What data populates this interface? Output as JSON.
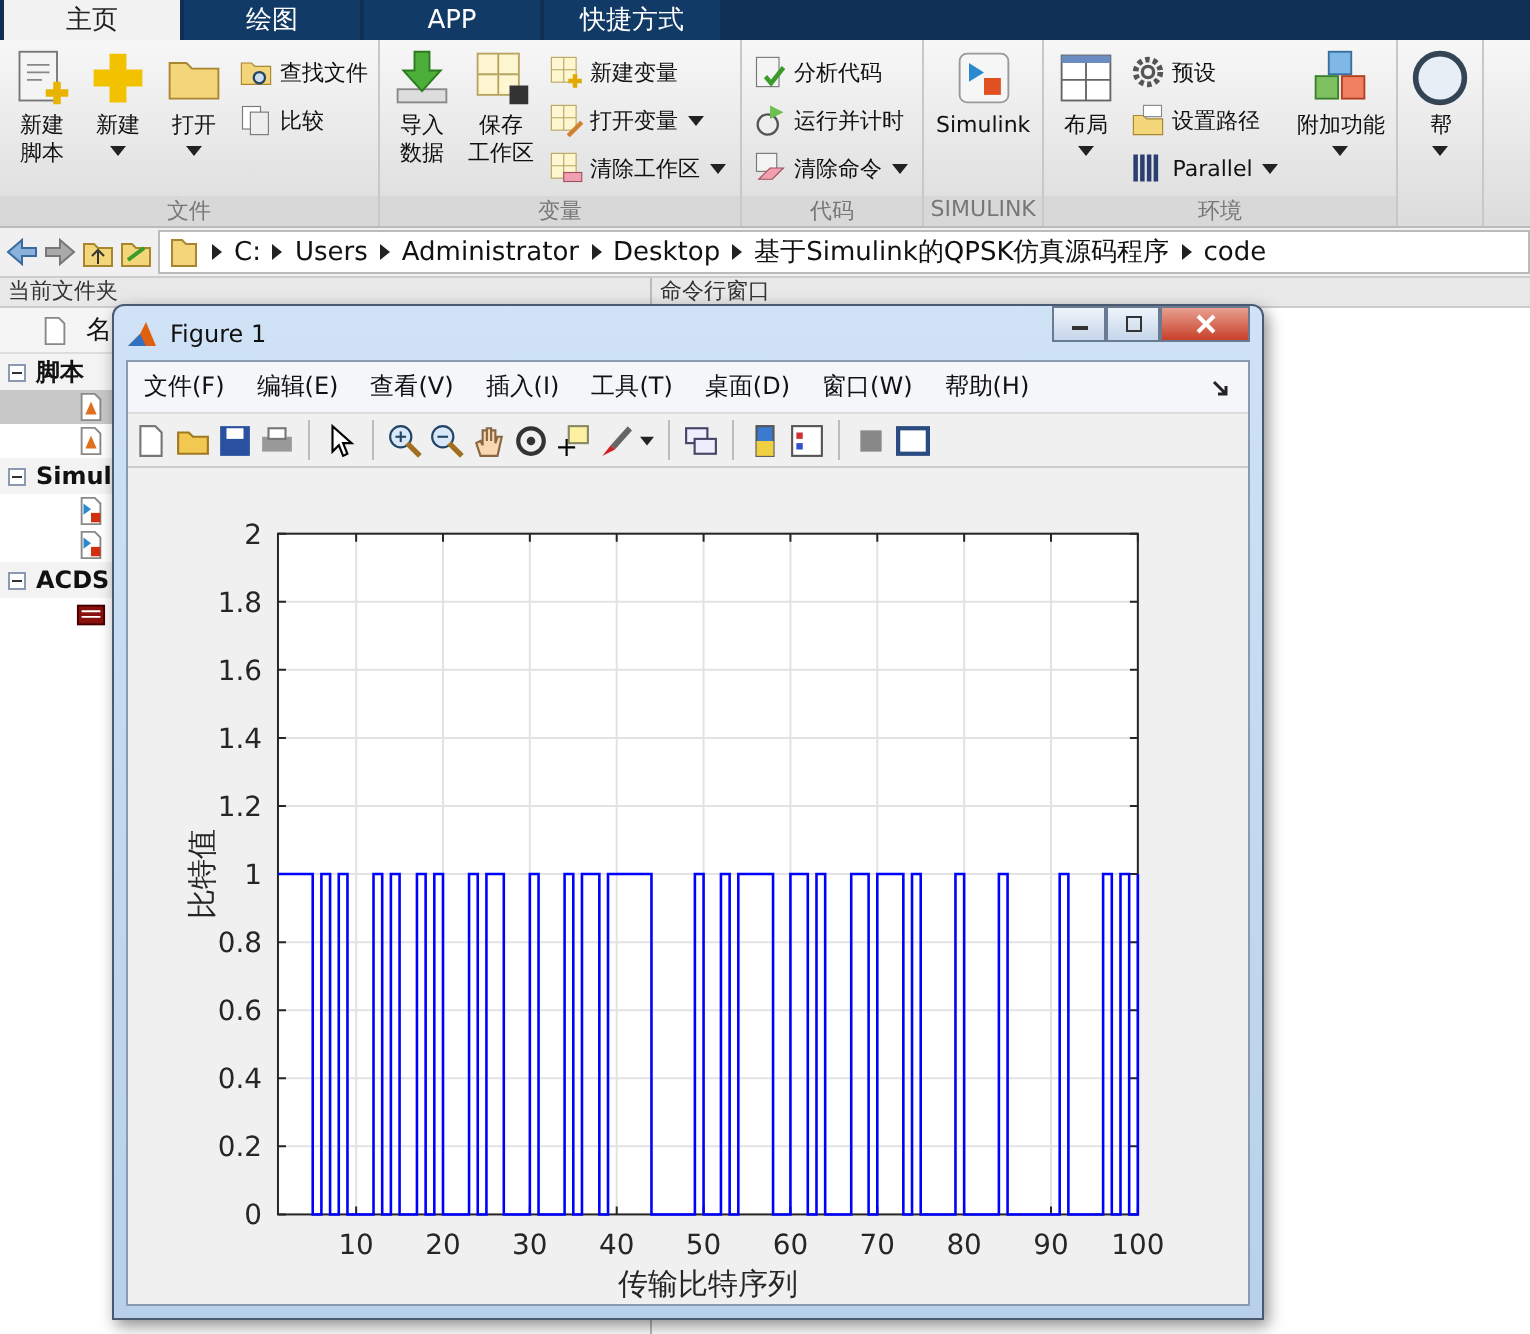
{
  "toolstrip_tabs": [
    {
      "label": "主页",
      "selected": true
    },
    {
      "label": "绘图",
      "selected": false
    },
    {
      "label": "APP",
      "selected": false
    },
    {
      "label": "快捷方式",
      "selected": false
    }
  ],
  "ribbon_groups": [
    {
      "title": "文件",
      "items": [
        {
          "kind": "large",
          "lines": [
            "新建",
            "脚本"
          ],
          "dropdown": false
        },
        {
          "kind": "large",
          "lines": [
            "新建"
          ],
          "dropdown": true
        },
        {
          "kind": "large",
          "lines": [
            "打开"
          ],
          "dropdown": true
        },
        {
          "kind": "stack",
          "items": [
            {
              "label": "查找文件",
              "dropdown": false
            },
            {
              "label": "比较",
              "dropdown": false
            }
          ]
        }
      ]
    },
    {
      "title": "变量",
      "items": [
        {
          "kind": "large",
          "lines": [
            "导入",
            "数据"
          ],
          "dropdown": false
        },
        {
          "kind": "large",
          "lines": [
            "保存",
            "工作区"
          ],
          "dropdown": false
        },
        {
          "kind": "stack",
          "items": [
            {
              "label": "新建变量",
              "dropdown": false
            },
            {
              "label": "打开变量",
              "dropdown": true
            },
            {
              "label": "清除工作区",
              "dropdown": true
            }
          ]
        }
      ]
    },
    {
      "title": "代码",
      "items": [
        {
          "kind": "stack",
          "items": [
            {
              "label": "分析代码",
              "dropdown": false
            },
            {
              "label": "运行并计时",
              "dropdown": false
            },
            {
              "label": "清除命令",
              "dropdown": true
            }
          ]
        }
      ]
    },
    {
      "title": "SIMULINK",
      "items": [
        {
          "kind": "large",
          "lines": [
            "Simulink"
          ],
          "dropdown": false
        }
      ]
    },
    {
      "title": "环境",
      "items": [
        {
          "kind": "large",
          "lines": [
            "布局"
          ],
          "dropdown": true
        },
        {
          "kind": "stack",
          "items": [
            {
              "label": "预设",
              "dropdown": false
            },
            {
              "label": "设置路径",
              "dropdown": false
            },
            {
              "label": "Parallel",
              "dropdown": true
            }
          ]
        },
        {
          "kind": "large",
          "lines": [
            "附加功能"
          ],
          "dropdown": true
        }
      ]
    },
    {
      "items": [
        {
          "kind": "large",
          "lines": [
            "帮"
          ],
          "dropdown": true
        }
      ]
    }
  ],
  "address_bar": {
    "path": [
      "C:",
      "Users",
      "Administrator",
      "Desktop",
      "基于Simulink的QPSK仿真源码程序",
      "code"
    ]
  },
  "current_folder": {
    "title": "当前文件夹",
    "column_1": "名",
    "groups": [
      {
        "label": "脚本",
        "expanded": true,
        "children": [
          {
            "kind": "m-file",
            "selected": true
          },
          {
            "kind": "m-file",
            "selected": false
          }
        ]
      },
      {
        "label": "Simul",
        "expanded": true,
        "children": [
          {
            "kind": "model",
            "selected": false
          },
          {
            "kind": "model",
            "selected": false
          }
        ]
      },
      {
        "label": "ACDS",
        "expanded": true,
        "children": [
          {
            "kind": "png",
            "selected": false
          }
        ]
      }
    ]
  },
  "command_window": {
    "title": "命令行窗口"
  },
  "figure": {
    "title": "Figure 1",
    "menu": [
      "文件(F)",
      "编辑(E)",
      "查看(V)",
      "插入(I)",
      "工具(T)",
      "桌面(D)",
      "窗口(W)",
      "帮助(H)"
    ],
    "chart_data": {
      "type": "line",
      "grid": true,
      "xlabel": "传输比特序列",
      "ylabel": "比特值",
      "xlim": [
        1,
        100
      ],
      "ylim": [
        0,
        2
      ],
      "xticks": [
        10,
        20,
        30,
        40,
        50,
        60,
        70,
        80,
        90,
        100
      ],
      "yticks": [
        0,
        0.2,
        0.4,
        0.6,
        0.8,
        1,
        1.2,
        1.4,
        1.6,
        1.8,
        2
      ],
      "x": [
        1,
        5,
        5,
        6,
        6,
        7,
        7,
        8,
        8,
        9,
        9,
        12,
        12,
        13,
        13,
        14,
        14,
        15,
        15,
        17,
        17,
        18,
        18,
        19,
        19,
        20,
        20,
        23,
        23,
        24,
        24,
        25,
        25,
        27,
        27,
        30,
        30,
        31,
        31,
        34,
        34,
        35,
        35,
        36,
        36,
        38,
        38,
        39,
        39,
        44,
        44,
        49,
        49,
        50,
        50,
        52,
        52,
        53,
        53,
        54,
        54,
        58,
        58,
        60,
        60,
        62,
        62,
        63,
        63,
        64,
        64,
        67,
        67,
        69,
        69,
        70,
        70,
        73,
        73,
        74,
        74,
        75,
        75,
        79,
        79,
        80,
        80,
        84,
        84,
        85,
        85,
        91,
        91,
        92,
        92,
        96,
        96,
        97,
        97,
        98,
        98,
        99,
        99,
        100,
        100
      ],
      "series": [
        {
          "color": "#0000ff",
          "values": [
            1,
            1,
            0,
            0,
            1,
            1,
            0,
            0,
            1,
            1,
            0,
            0,
            1,
            1,
            0,
            0,
            1,
            1,
            0,
            0,
            1,
            1,
            0,
            0,
            1,
            1,
            0,
            0,
            1,
            1,
            0,
            0,
            1,
            1,
            0,
            0,
            1,
            1,
            0,
            0,
            1,
            1,
            0,
            0,
            1,
            1,
            0,
            0,
            1,
            1,
            0,
            0,
            1,
            1,
            0,
            0,
            1,
            1,
            0,
            0,
            1,
            1,
            0,
            0,
            1,
            1,
            0,
            0,
            1,
            1,
            0,
            0,
            1,
            1,
            0,
            0,
            1,
            1,
            0,
            0,
            1,
            1,
            0,
            0,
            1,
            1,
            0,
            0,
            1,
            1,
            0,
            0,
            1,
            1,
            0,
            0,
            1,
            1,
            0,
            0,
            1,
            1,
            0,
            0,
            1
          ]
        }
      ]
    }
  }
}
